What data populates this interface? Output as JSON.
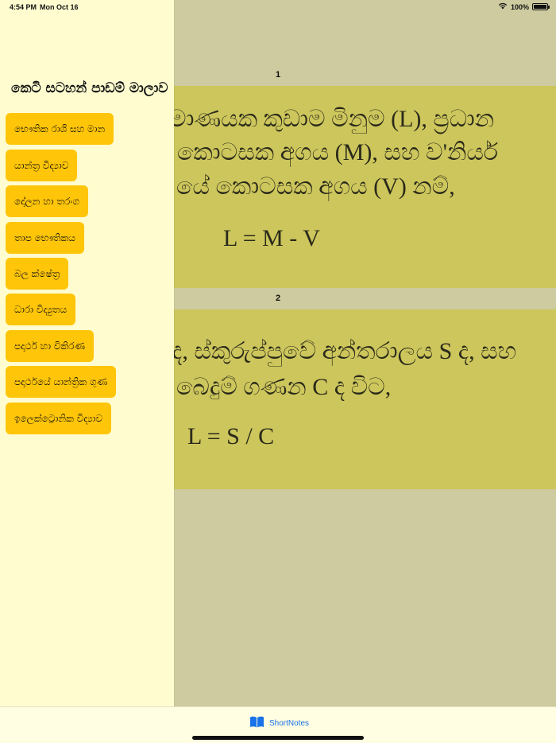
{
  "status_bar": {
    "time": "4:54 PM",
    "date": "Mon Oct 16",
    "battery": "100%",
    "battery_level": 1.0,
    "wifi_icon": "wifi-icon"
  },
  "sidebar": {
    "title": "කෙටි සටහන් පාඩම් මාලාව",
    "items": [
      {
        "label": "භෞතික රාශි සහ මාන"
      },
      {
        "label": "යාන්ත්‍ර විද්‍යාව"
      },
      {
        "label": "දෝලන හා තරංග"
      },
      {
        "label": "තාප භෞතිකය"
      },
      {
        "label": "බල ක්ෂේත්‍ර"
      },
      {
        "label": "ධාරා විද්‍යුතය"
      },
      {
        "label": "පදාර්ථ හා විකිරණ"
      },
      {
        "label": "පදාර්ථයේ යාන්ත්‍රික ගුණ"
      },
      {
        "label": "ඉලෙක්ට්‍රොනික විද්‍යාව"
      }
    ]
  },
  "notes": [
    {
      "number": "1",
      "lines": [
        "මාණයක කුඩාම මිනුම (L), ප්‍රධාන",
        "කොටසක අගය (M), සහ ව'නියර්",
        "යේ කොටසක අගය (V) නම්,"
      ],
      "formula": "L = M - V"
    },
    {
      "number": "2",
      "lines": [
        "ද, ස්කුරුප්පුවේ අන්තරාලය S ද, සහ",
        "බෙදුම් ගණන C ද විට,"
      ],
      "formula": "L = S / C"
    }
  ],
  "tab_bar": {
    "tab_label": "ShortNotes",
    "tab_icon": "book-icon",
    "active_color": "#1a73e8"
  },
  "colors": {
    "sidebar_bg": "#fffdd0",
    "button_bg": "#ffc508",
    "card_bg": "#cdc65c",
    "dim_bg": "#cdcb9f"
  }
}
